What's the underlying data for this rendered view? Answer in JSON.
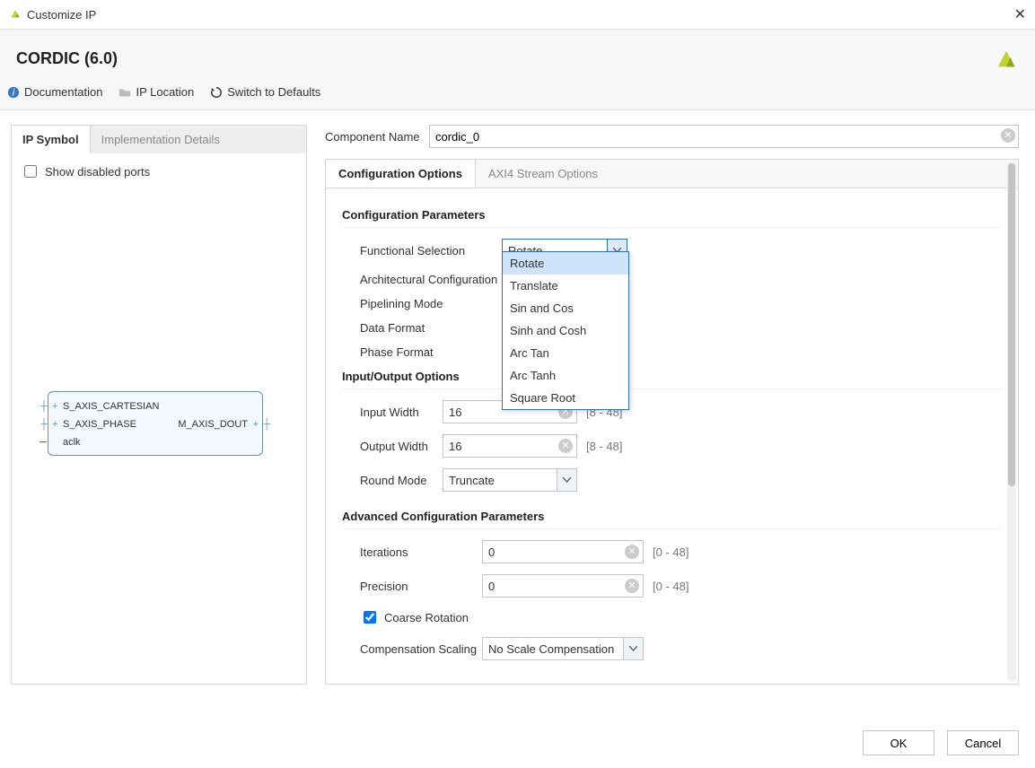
{
  "title": "Customize IP",
  "ip_name": "CORDIC (6.0)",
  "toolbar": {
    "doc": "Documentation",
    "loc": "IP Location",
    "reset": "Switch to Defaults"
  },
  "left_tabs": {
    "sym": "IP Symbol",
    "impl": "Implementation Details"
  },
  "show_disabled": "Show disabled ports",
  "symbol": {
    "p1": "S_AXIS_CARTESIAN",
    "p2": "S_AXIS_PHASE",
    "p3": "M_AXIS_DOUT",
    "p4": "aclk"
  },
  "comp_label": "Component Name",
  "comp_value": "cordic_0",
  "main_tabs": {
    "cfg": "Configuration Options",
    "axi": "AXI4 Stream Options"
  },
  "sections": {
    "cfg_params": "Configuration Parameters",
    "io_opts": "Input/Output Options",
    "adv_params": "Advanced Configuration Parameters"
  },
  "fields": {
    "func_sel": {
      "label": "Functional Selection",
      "value": "Rotate"
    },
    "arch_cfg": {
      "label": "Architectural Configuration"
    },
    "pipe_mode": {
      "label": "Pipelining Mode"
    },
    "data_fmt": {
      "label": "Data Format"
    },
    "phase_fmt": {
      "label": "Phase Format"
    },
    "in_width": {
      "label": "Input Width",
      "value": "16",
      "hint": "[8 - 48]"
    },
    "out_width": {
      "label": "Output Width",
      "value": "16",
      "hint": "[8 - 48]"
    },
    "round_mode": {
      "label": "Round Mode",
      "value": "Truncate"
    },
    "iterations": {
      "label": "Iterations",
      "value": "0",
      "hint": "[0 - 48]"
    },
    "precision": {
      "label": "Precision",
      "value": "0",
      "hint": "[0 - 48]"
    },
    "coarse_rot": "Coarse Rotation",
    "comp_scaling": {
      "label": "Compensation Scaling",
      "value": "No Scale Compensation"
    }
  },
  "func_sel_options": [
    "Rotate",
    "Translate",
    "Sin and Cos",
    "Sinh and Cosh",
    "Arc Tan",
    "Arc Tanh",
    "Square Root"
  ],
  "buttons": {
    "ok": "OK",
    "cancel": "Cancel"
  }
}
